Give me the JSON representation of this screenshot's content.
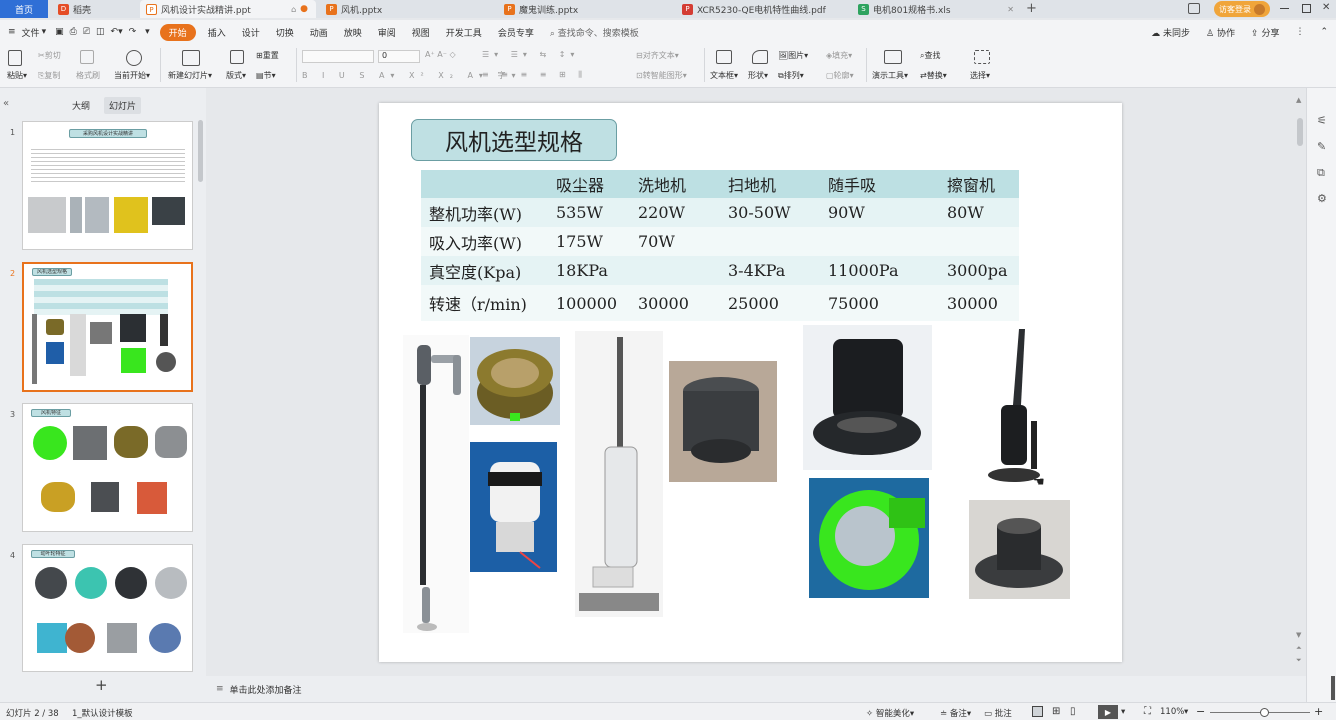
{
  "tabs": [
    {
      "label": "首页",
      "active": true
    },
    {
      "label": "稻壳"
    },
    {
      "label": "风机设计实战精讲.ppt"
    },
    {
      "label": "风机.pptx"
    },
    {
      "label": "魔鬼训练.pptx"
    },
    {
      "label": "XCR5230-QE电机特性曲线.pdf"
    },
    {
      "label": "电机801规格书.xls"
    }
  ],
  "account": {
    "login_label": "访客登录"
  },
  "menu": {
    "file": "文件",
    "items": [
      "开始",
      "插入",
      "设计",
      "切换",
      "动画",
      "放映",
      "审阅",
      "视图",
      "开发工具",
      "会员专享"
    ],
    "search_placeholder": "查找命令、搜索模板",
    "unsync": "未同步",
    "collab": "协作",
    "share": "分享"
  },
  "ribbon": {
    "paste": "粘贴",
    "cut": "剪切",
    "copy": "复制",
    "format_painter": "格式刷",
    "from_start": "当前开始",
    "new_slide": "新建幻灯片",
    "layout": "版式",
    "section": "节",
    "reset": "重置",
    "font_size": "0",
    "align_text": "对齐文本",
    "smartart": "转智能图形",
    "textbox": "文本框",
    "shapes": "形状",
    "picture": "图片",
    "arrange": "排列",
    "fill": "填充",
    "outline": "轮廓",
    "present_tools": "演示工具",
    "find": "查找",
    "replace": "替换",
    "select": "选择"
  },
  "pane": {
    "tab_outline": "大纲",
    "tab_slides": "幻灯片"
  },
  "thumbnails": [
    {
      "num": "1",
      "title": "采购风机设计实战精讲"
    },
    {
      "num": "2",
      "title": "风机选型规格"
    },
    {
      "num": "3",
      "title": "风机特征"
    },
    {
      "num": "4",
      "title": "动叶轮特征"
    }
  ],
  "slide": {
    "title": "风机选型规格",
    "table": {
      "headers": [
        "",
        "吸尘器",
        "洗地机",
        "扫地机",
        "随手吸",
        "擦窗机"
      ],
      "rows": [
        [
          "整机功率(W)",
          "535W",
          "220W",
          "30-50W",
          "90W",
          "80W"
        ],
        [
          "吸入功率(W)",
          "175W",
          "70W",
          "",
          "",
          ""
        ],
        [
          "真空度(Kpa)",
          "18KPa",
          "",
          "3-4KPa",
          "11000Pa",
          "3000pa"
        ],
        [
          "转速（r/min)",
          "100000",
          "30000",
          "25000",
          "75000",
          "30000"
        ]
      ]
    }
  },
  "notes_placeholder": "单击此处添加备注",
  "status": {
    "slide_info": "幻灯片 2 / 38",
    "theme": "1_默认设计模板",
    "beautify": "智能美化",
    "notes": "备注",
    "comments": "批注",
    "zoom": "110%"
  },
  "colors": {
    "accent": "#e8721c",
    "table_header": "#bde0e3",
    "table_row": "#e5f3f4",
    "fan_green": "#39e61e"
  }
}
